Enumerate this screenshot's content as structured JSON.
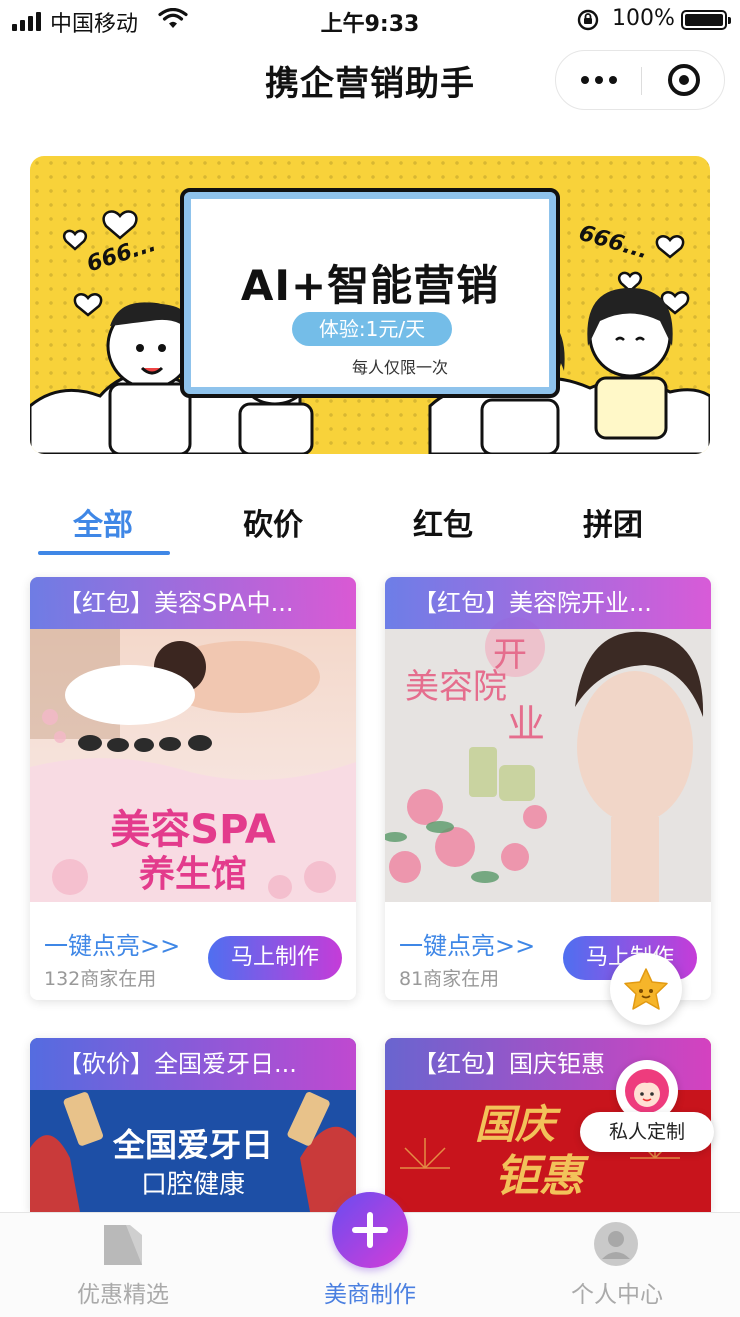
{
  "status_bar": {
    "carrier": "中国移动",
    "time": "上午9:33",
    "battery": "100%",
    "battery_level": 1.0
  },
  "nav": {
    "title": "携企营销助手",
    "more_icon": "more-dots-icon",
    "close_icon": "close-circle-icon"
  },
  "banner": {
    "headline": "AI+智能营销",
    "price_pill": "体验:1元/天",
    "note": "每人仅限一次",
    "decor_text_left": "666...",
    "decor_text_right": "666...",
    "colors": {
      "background": "#f8d23a",
      "frame_border": "#8fc3ec",
      "pill": "#74bde8"
    }
  },
  "tabs": {
    "items": [
      "全部",
      "砍价",
      "红包",
      "拼团"
    ],
    "active_index": 0,
    "active_color": "#3f87e6"
  },
  "cards": [
    {
      "title": "【红包】美容SPA中...",
      "image_text_1": "美容SPA",
      "image_text_2": "养生馆",
      "cta": "一键点亮>>",
      "users": "132商家在用",
      "button": "马上制作"
    },
    {
      "title": "【红包】美容院开业...",
      "image_text_1": "开",
      "image_text_2": "美容院",
      "image_text_3": "业",
      "cta": "一键点亮>>",
      "users": "81商家在用",
      "button": "马上制作"
    },
    {
      "title": "【砍价】全国爱牙日...",
      "image_text_1": "全国爱牙日",
      "image_text_2": "口腔健康"
    },
    {
      "title": "【红包】国庆钜惠",
      "image_text_1": "国庆",
      "image_text_2": "钜惠"
    }
  ],
  "floating": {
    "star_icon": "star-icon",
    "custom_label": "私人定制",
    "custom_icon": "avatar-face-icon"
  },
  "tabbar": {
    "items": [
      {
        "label": "优惠精选",
        "icon": "bookmark-icon"
      },
      {
        "label": "美商制作",
        "icon": "plus-icon"
      },
      {
        "label": "个人中心",
        "icon": "user-icon"
      }
    ],
    "active_index": 1,
    "active_color": "#4a7fe0"
  }
}
